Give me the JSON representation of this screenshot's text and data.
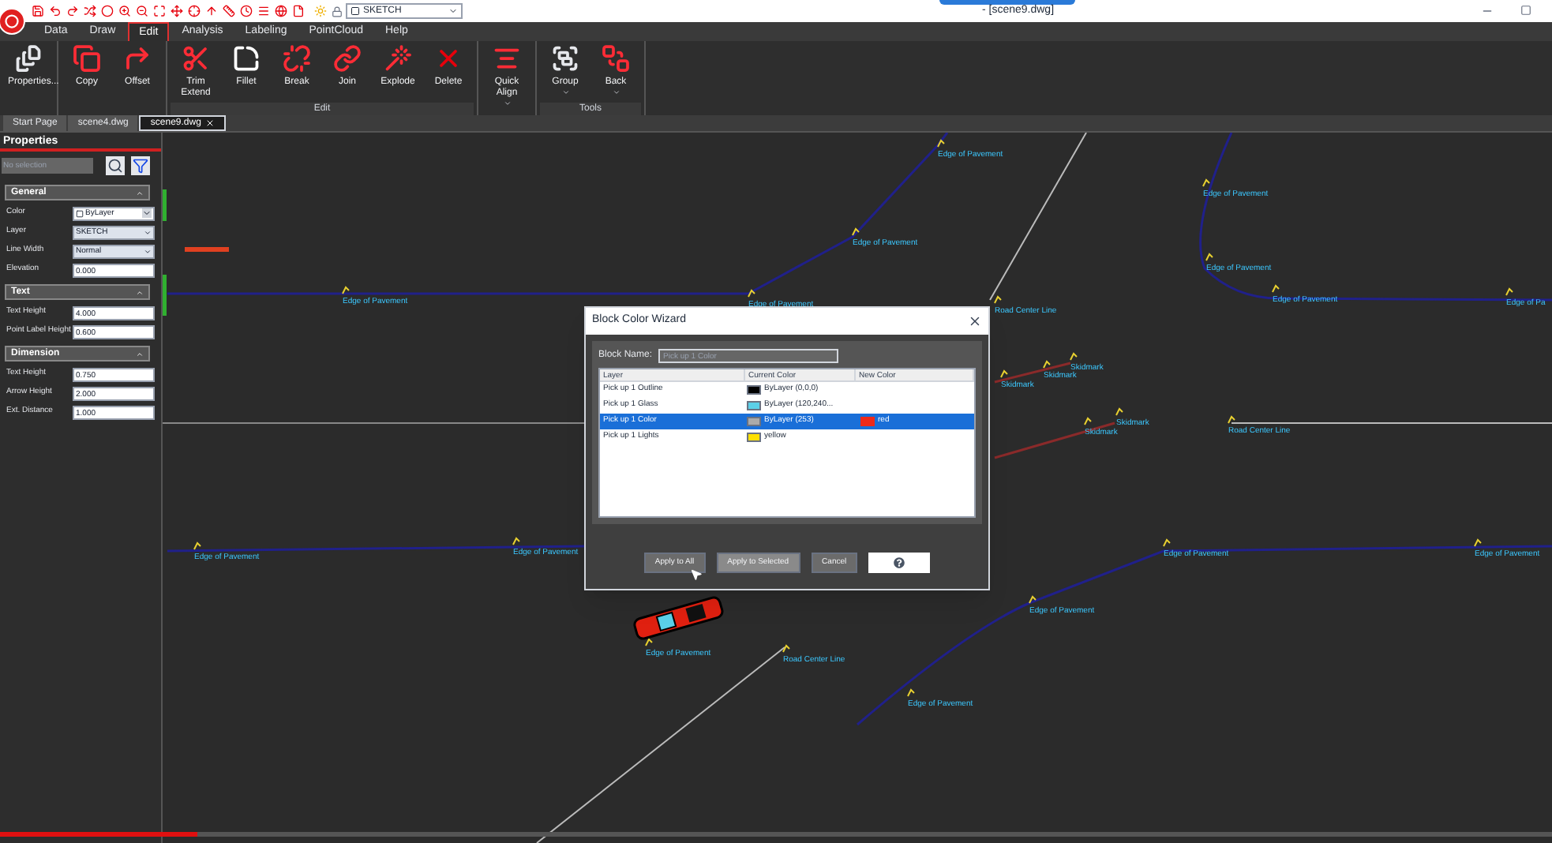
{
  "title_bar": {
    "title": "- [scene9.dwg]",
    "layer": "SKETCH"
  },
  "ribbon_tabs": [
    {
      "label": "Data",
      "selected": false
    },
    {
      "label": "Draw",
      "selected": false
    },
    {
      "label": "Edit",
      "selected": true
    },
    {
      "label": "Analysis",
      "selected": false
    },
    {
      "label": "Labeling",
      "selected": false
    },
    {
      "label": "PointCloud",
      "selected": false
    },
    {
      "label": "Help",
      "selected": false
    }
  ],
  "ribbon_groups": [
    {
      "tools": [
        {
          "label": "Properties...",
          "dropdown": false
        }
      ]
    },
    {
      "tools": [
        {
          "label": "Copy",
          "dropdown": false
        },
        {
          "label": "Offset",
          "dropdown": false
        }
      ]
    },
    {
      "label": "Edit",
      "tools": [
        {
          "label": "Trim Extend",
          "dropdown": false
        },
        {
          "label": "Fillet",
          "dropdown": false
        },
        {
          "label": "Break",
          "dropdown": false
        },
        {
          "label": "Join",
          "dropdown": false
        },
        {
          "label": "Explode",
          "dropdown": false
        },
        {
          "label": "Delete",
          "dropdown": false
        }
      ]
    },
    {
      "tools": [
        {
          "label": "Quick Align",
          "dropdown": true
        }
      ]
    },
    {
      "label": "Tools",
      "tools": [
        {
          "label": "Group",
          "dropdown": true
        },
        {
          "label": "Back",
          "dropdown": true
        }
      ]
    }
  ],
  "doc_tabs": [
    {
      "label": "Start Page",
      "selected": false
    },
    {
      "label": "scene4.dwg",
      "selected": false
    },
    {
      "label": "scene9.dwg",
      "selected": true
    }
  ],
  "properties": {
    "title": "Properties",
    "selection": "No selection",
    "sections": [
      {
        "title": "General",
        "expanded": true,
        "rows": [
          {
            "label": "Color",
            "value": "ByLayer",
            "kind": "color-dropdown"
          },
          {
            "label": "Layer",
            "value": "SKETCH",
            "kind": "dropdown"
          },
          {
            "label": "Line Width",
            "value": "Normal",
            "kind": "dropdown"
          },
          {
            "label": "Elevation",
            "value": "0.000",
            "kind": "input"
          }
        ]
      },
      {
        "title": "Text",
        "expanded": true,
        "rows": [
          {
            "label": "Text Height",
            "value": "4.000",
            "kind": "input"
          },
          {
            "label": "Point Label Height",
            "value": "0.600",
            "kind": "input"
          }
        ]
      },
      {
        "title": "Dimension",
        "expanded": true,
        "rows": [
          {
            "label": "Text Height",
            "value": "0.750",
            "kind": "input"
          },
          {
            "label": "Arrow Height",
            "value": "2.000",
            "kind": "input"
          },
          {
            "label": "Ext. Distance",
            "value": "1.000",
            "kind": "input"
          }
        ]
      }
    ]
  },
  "canvas": {
    "labels": [
      {
        "text": "Edge of Pavement"
      },
      {
        "text": "Edge of Pavement"
      },
      {
        "text": "Edge of Pavement"
      },
      {
        "text": "Edge of Pavement"
      },
      {
        "text": "Road Center Line"
      },
      {
        "text": "Edge of Pavement"
      },
      {
        "text": "Edge of Pavement"
      },
      {
        "text": "Edge of Pavement"
      },
      {
        "text": "Edge of Pa"
      },
      {
        "text": "Skidmark"
      },
      {
        "text": "Skidmark"
      },
      {
        "text": "Skidmark"
      },
      {
        "text": "Skidmark"
      },
      {
        "text": "Skidmark"
      },
      {
        "text": "Road Center Line"
      },
      {
        "text": "Edge of Pavement"
      },
      {
        "text": "Edge of Pavement"
      },
      {
        "text": "Edge of Pavement"
      },
      {
        "text": "Edge of Pavement"
      },
      {
        "text": "Edge of Pavement"
      },
      {
        "text": "Road Center Line"
      },
      {
        "text": "Edge of Pavement"
      },
      {
        "text": "Edge of Pavement"
      }
    ]
  },
  "dialog": {
    "title": "Block Color Wizard",
    "block_name_label": "Block Name:",
    "block_name": "Pick up 1 Color",
    "columns": [
      "Layer",
      "Current Color",
      "New Color"
    ],
    "rows": [
      {
        "layer": "Pick up 1 Outline",
        "current": "ByLayer (0,0,0)",
        "color": "#000000",
        "selected": false
      },
      {
        "layer": "Pick up 1 Glass",
        "current": "ByLayer (120,240...",
        "color": "#5bd0e8",
        "selected": false
      },
      {
        "layer": "Pick up 1 Color",
        "current": "ByLayer (253)",
        "color": "#aaaaaa",
        "new": {
          "text": "red",
          "color": "#ee2a1a"
        },
        "selected": true
      },
      {
        "layer": "Pick up 1 Lights",
        "current": "yellow",
        "color": "#ffe000",
        "selected": false
      }
    ],
    "buttons": [
      {
        "label": "Apply to All",
        "kind": "normal"
      },
      {
        "label": "Apply to Selected",
        "kind": "highlight"
      },
      {
        "label": "Cancel",
        "kind": "normal"
      },
      {
        "kind": "help"
      }
    ]
  },
  "video_progress": {
    "level": 0.127
  }
}
